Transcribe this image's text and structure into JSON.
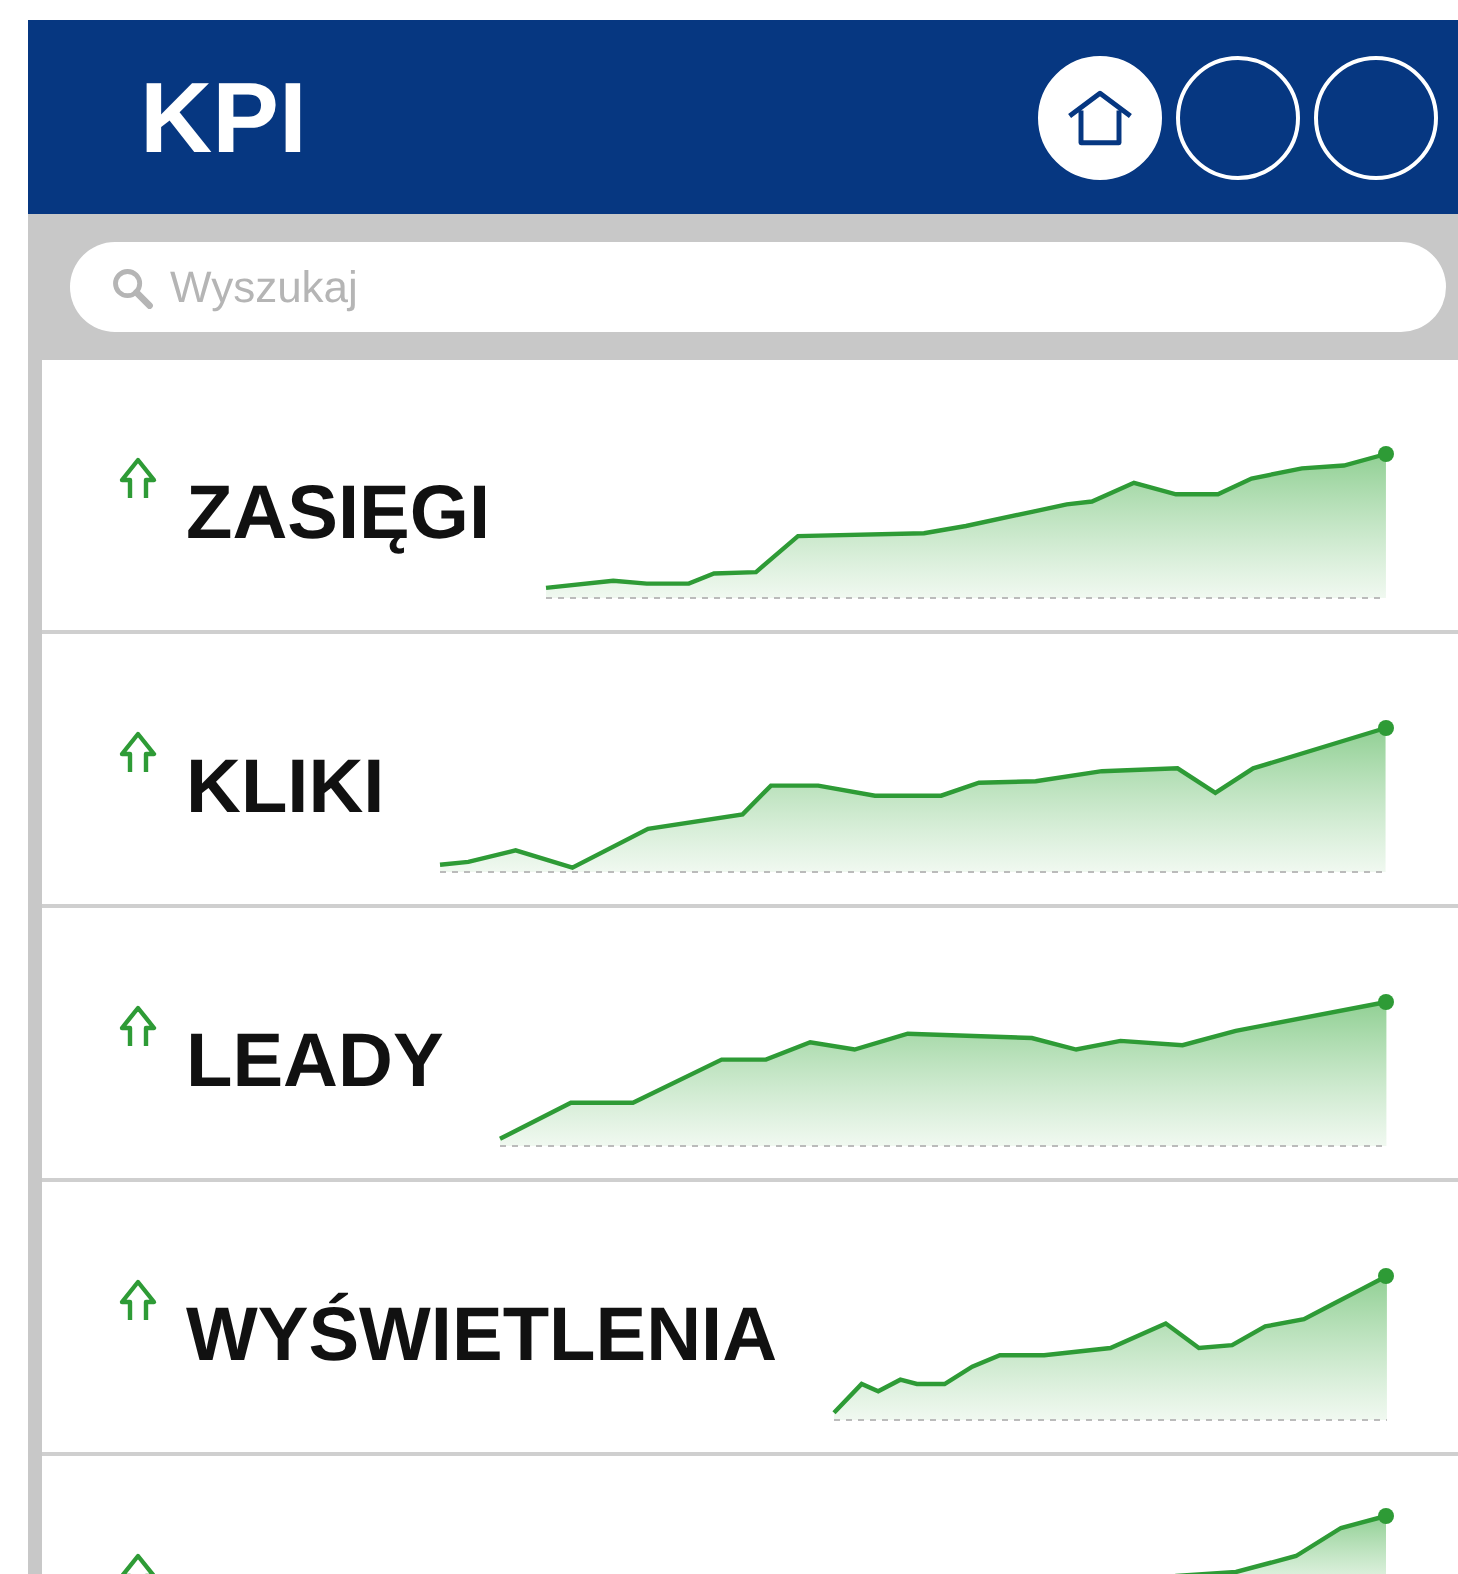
{
  "header": {
    "title": "KPI",
    "nav": [
      {
        "kind": "home",
        "selected": true
      },
      {
        "kind": "blank",
        "selected": false
      },
      {
        "kind": "blank",
        "selected": false
      }
    ]
  },
  "search": {
    "placeholder": "Wyszukaj"
  },
  "kpis": [
    {
      "label": "ZASIĘGI",
      "kind": "up"
    },
    {
      "label": "KLIKI",
      "kind": "up"
    },
    {
      "label": "LEADY",
      "kind": "up"
    },
    {
      "label": "WYŚWIETLENIA",
      "kind": "up"
    },
    {
      "kind": "up"
    }
  ]
}
